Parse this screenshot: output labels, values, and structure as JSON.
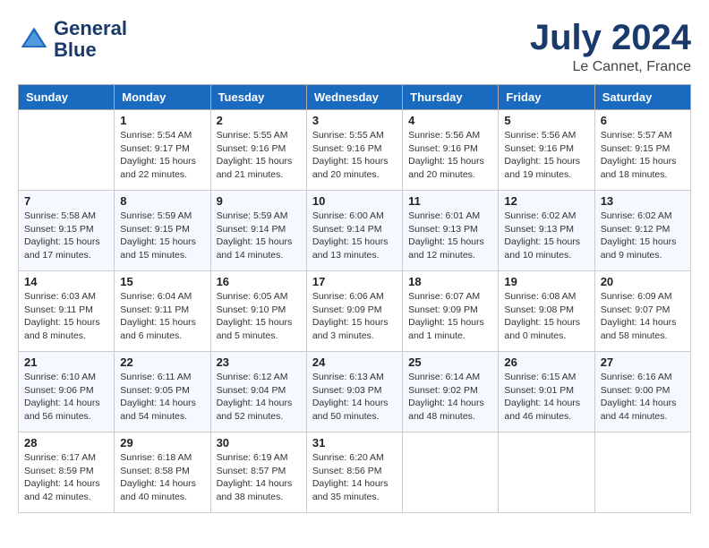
{
  "logo": {
    "name": "GeneralBlue",
    "line1": "General",
    "line2": "Blue"
  },
  "title": "July 2024",
  "location": "Le Cannet, France",
  "headers": [
    "Sunday",
    "Monday",
    "Tuesday",
    "Wednesday",
    "Thursday",
    "Friday",
    "Saturday"
  ],
  "weeks": [
    [
      {
        "day": "",
        "sunrise": "",
        "sunset": "",
        "daylight": ""
      },
      {
        "day": "1",
        "sunrise": "Sunrise: 5:54 AM",
        "sunset": "Sunset: 9:17 PM",
        "daylight": "Daylight: 15 hours and 22 minutes."
      },
      {
        "day": "2",
        "sunrise": "Sunrise: 5:55 AM",
        "sunset": "Sunset: 9:16 PM",
        "daylight": "Daylight: 15 hours and 21 minutes."
      },
      {
        "day": "3",
        "sunrise": "Sunrise: 5:55 AM",
        "sunset": "Sunset: 9:16 PM",
        "daylight": "Daylight: 15 hours and 20 minutes."
      },
      {
        "day": "4",
        "sunrise": "Sunrise: 5:56 AM",
        "sunset": "Sunset: 9:16 PM",
        "daylight": "Daylight: 15 hours and 20 minutes."
      },
      {
        "day": "5",
        "sunrise": "Sunrise: 5:56 AM",
        "sunset": "Sunset: 9:16 PM",
        "daylight": "Daylight: 15 hours and 19 minutes."
      },
      {
        "day": "6",
        "sunrise": "Sunrise: 5:57 AM",
        "sunset": "Sunset: 9:15 PM",
        "daylight": "Daylight: 15 hours and 18 minutes."
      }
    ],
    [
      {
        "day": "7",
        "sunrise": "Sunrise: 5:58 AM",
        "sunset": "Sunset: 9:15 PM",
        "daylight": "Daylight: 15 hours and 17 minutes."
      },
      {
        "day": "8",
        "sunrise": "Sunrise: 5:59 AM",
        "sunset": "Sunset: 9:15 PM",
        "daylight": "Daylight: 15 hours and 15 minutes."
      },
      {
        "day": "9",
        "sunrise": "Sunrise: 5:59 AM",
        "sunset": "Sunset: 9:14 PM",
        "daylight": "Daylight: 15 hours and 14 minutes."
      },
      {
        "day": "10",
        "sunrise": "Sunrise: 6:00 AM",
        "sunset": "Sunset: 9:14 PM",
        "daylight": "Daylight: 15 hours and 13 minutes."
      },
      {
        "day": "11",
        "sunrise": "Sunrise: 6:01 AM",
        "sunset": "Sunset: 9:13 PM",
        "daylight": "Daylight: 15 hours and 12 minutes."
      },
      {
        "day": "12",
        "sunrise": "Sunrise: 6:02 AM",
        "sunset": "Sunset: 9:13 PM",
        "daylight": "Daylight: 15 hours and 10 minutes."
      },
      {
        "day": "13",
        "sunrise": "Sunrise: 6:02 AM",
        "sunset": "Sunset: 9:12 PM",
        "daylight": "Daylight: 15 hours and 9 minutes."
      }
    ],
    [
      {
        "day": "14",
        "sunrise": "Sunrise: 6:03 AM",
        "sunset": "Sunset: 9:11 PM",
        "daylight": "Daylight: 15 hours and 8 minutes."
      },
      {
        "day": "15",
        "sunrise": "Sunrise: 6:04 AM",
        "sunset": "Sunset: 9:11 PM",
        "daylight": "Daylight: 15 hours and 6 minutes."
      },
      {
        "day": "16",
        "sunrise": "Sunrise: 6:05 AM",
        "sunset": "Sunset: 9:10 PM",
        "daylight": "Daylight: 15 hours and 5 minutes."
      },
      {
        "day": "17",
        "sunrise": "Sunrise: 6:06 AM",
        "sunset": "Sunset: 9:09 PM",
        "daylight": "Daylight: 15 hours and 3 minutes."
      },
      {
        "day": "18",
        "sunrise": "Sunrise: 6:07 AM",
        "sunset": "Sunset: 9:09 PM",
        "daylight": "Daylight: 15 hours and 1 minute."
      },
      {
        "day": "19",
        "sunrise": "Sunrise: 6:08 AM",
        "sunset": "Sunset: 9:08 PM",
        "daylight": "Daylight: 15 hours and 0 minutes."
      },
      {
        "day": "20",
        "sunrise": "Sunrise: 6:09 AM",
        "sunset": "Sunset: 9:07 PM",
        "daylight": "Daylight: 14 hours and 58 minutes."
      }
    ],
    [
      {
        "day": "21",
        "sunrise": "Sunrise: 6:10 AM",
        "sunset": "Sunset: 9:06 PM",
        "daylight": "Daylight: 14 hours and 56 minutes."
      },
      {
        "day": "22",
        "sunrise": "Sunrise: 6:11 AM",
        "sunset": "Sunset: 9:05 PM",
        "daylight": "Daylight: 14 hours and 54 minutes."
      },
      {
        "day": "23",
        "sunrise": "Sunrise: 6:12 AM",
        "sunset": "Sunset: 9:04 PM",
        "daylight": "Daylight: 14 hours and 52 minutes."
      },
      {
        "day": "24",
        "sunrise": "Sunrise: 6:13 AM",
        "sunset": "Sunset: 9:03 PM",
        "daylight": "Daylight: 14 hours and 50 minutes."
      },
      {
        "day": "25",
        "sunrise": "Sunrise: 6:14 AM",
        "sunset": "Sunset: 9:02 PM",
        "daylight": "Daylight: 14 hours and 48 minutes."
      },
      {
        "day": "26",
        "sunrise": "Sunrise: 6:15 AM",
        "sunset": "Sunset: 9:01 PM",
        "daylight": "Daylight: 14 hours and 46 minutes."
      },
      {
        "day": "27",
        "sunrise": "Sunrise: 6:16 AM",
        "sunset": "Sunset: 9:00 PM",
        "daylight": "Daylight: 14 hours and 44 minutes."
      }
    ],
    [
      {
        "day": "28",
        "sunrise": "Sunrise: 6:17 AM",
        "sunset": "Sunset: 8:59 PM",
        "daylight": "Daylight: 14 hours and 42 minutes."
      },
      {
        "day": "29",
        "sunrise": "Sunrise: 6:18 AM",
        "sunset": "Sunset: 8:58 PM",
        "daylight": "Daylight: 14 hours and 40 minutes."
      },
      {
        "day": "30",
        "sunrise": "Sunrise: 6:19 AM",
        "sunset": "Sunset: 8:57 PM",
        "daylight": "Daylight: 14 hours and 38 minutes."
      },
      {
        "day": "31",
        "sunrise": "Sunrise: 6:20 AM",
        "sunset": "Sunset: 8:56 PM",
        "daylight": "Daylight: 14 hours and 35 minutes."
      },
      {
        "day": "",
        "sunrise": "",
        "sunset": "",
        "daylight": ""
      },
      {
        "day": "",
        "sunrise": "",
        "sunset": "",
        "daylight": ""
      },
      {
        "day": "",
        "sunrise": "",
        "sunset": "",
        "daylight": ""
      }
    ]
  ]
}
